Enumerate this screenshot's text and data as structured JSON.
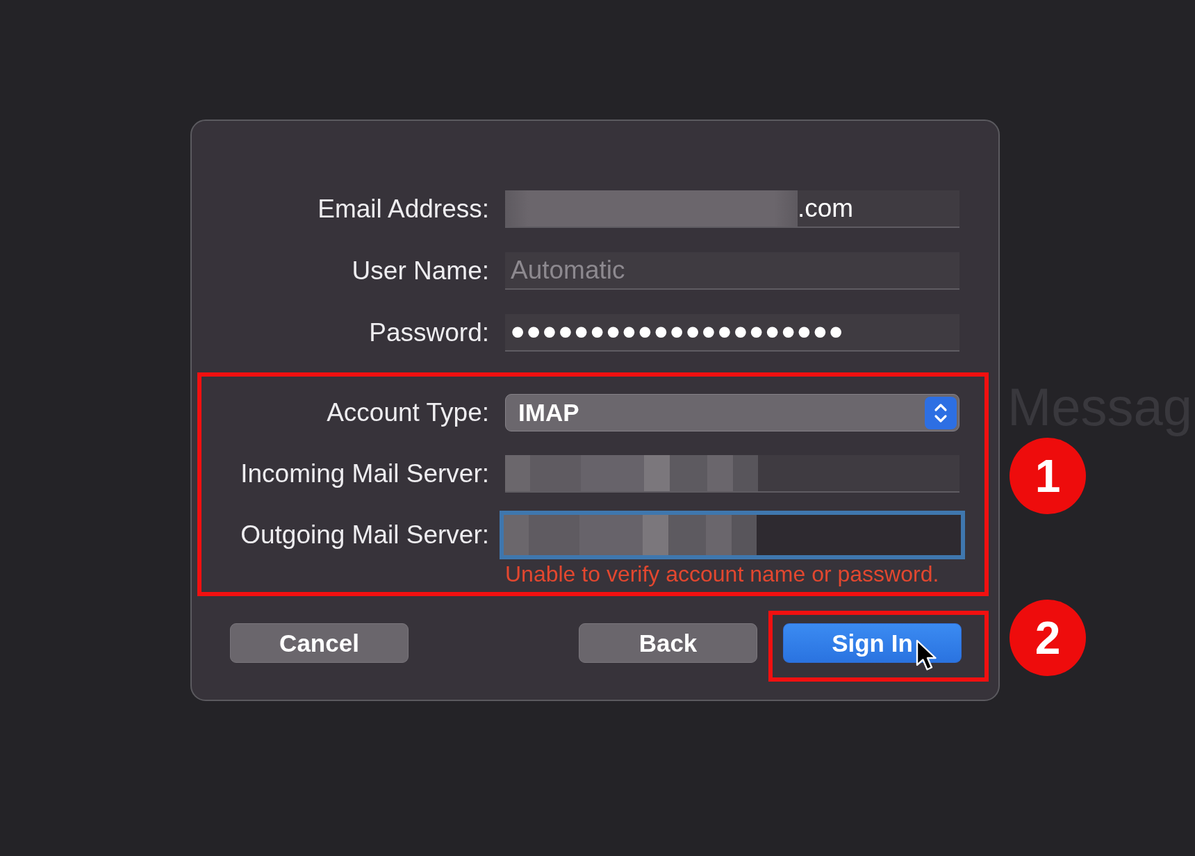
{
  "background_text": "Messag",
  "dialog": {
    "sections": [
      {
        "highlighted": false,
        "fields": [
          {
            "kind": "text",
            "label": "Email Address:",
            "redaction": {
              "kind": "blur"
            },
            "value": ".com",
            "focused": false
          },
          {
            "kind": "text",
            "label": "User Name:",
            "placeholder": "Automatic",
            "focused": false
          },
          {
            "kind": "password",
            "label": "Password:",
            "value": "•••••••••••••••••••••",
            "focused": false
          }
        ]
      },
      {
        "highlighted": true,
        "badge": "1",
        "fields": [
          {
            "kind": "popup",
            "label": "Account Type:",
            "value": "IMAP",
            "focused": false
          },
          {
            "kind": "text",
            "label": "Incoming Mail Server:",
            "redaction": {
              "kind": "pixelate"
            },
            "focused": false
          },
          {
            "kind": "text",
            "label": "Outgoing Mail Server:",
            "redaction": {
              "kind": "pixelate"
            },
            "focused": true
          }
        ],
        "error": "Unable to verify account name or password."
      }
    ],
    "buttons": [
      {
        "label": "Cancel",
        "kind": "secondary",
        "highlighted": false,
        "cursor": false
      },
      {
        "label": "Back",
        "kind": "secondary",
        "highlighted": false,
        "cursor": false
      },
      {
        "label": "Sign In",
        "kind": "primary",
        "highlighted": true,
        "badge": "2",
        "cursor": true
      }
    ]
  }
}
